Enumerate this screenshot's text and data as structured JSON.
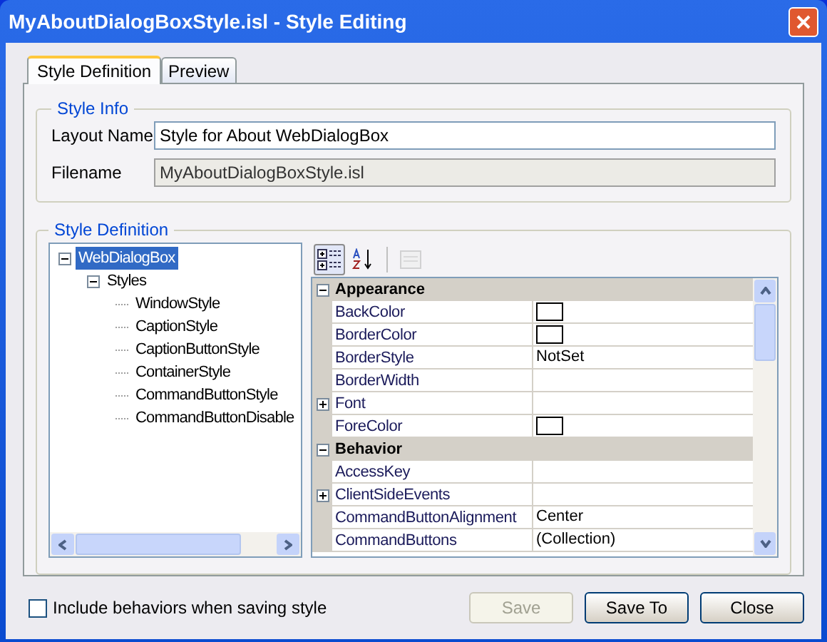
{
  "window": {
    "title": "MyAboutDialogBoxStyle.isl - Style Editing"
  },
  "tabs": [
    {
      "label": "Style Definition",
      "selected": true
    },
    {
      "label": "Preview",
      "selected": false
    }
  ],
  "style_info": {
    "legend": "Style Info",
    "fields": [
      {
        "label": "Layout Name",
        "value": "Style for About WebDialogBox",
        "disabled": false
      },
      {
        "label": "Filename",
        "value": "MyAboutDialogBoxStyle.isl",
        "disabled": true
      }
    ]
  },
  "style_definition": {
    "legend": "Style Definition",
    "tree": [
      {
        "label": "WebDialogBox",
        "selected": true,
        "expanded": true,
        "children": [
          {
            "label": "Styles",
            "selected": false,
            "expanded": true,
            "children": [
              {
                "label": "WindowStyle",
                "selected": false
              },
              {
                "label": "CaptionStyle",
                "selected": false
              },
              {
                "label": "CaptionButtonStyle",
                "selected": false
              },
              {
                "label": "ContainerStyle",
                "selected": false
              },
              {
                "label": "CommandButtonStyle",
                "selected": false
              },
              {
                "label": "CommandButtonDisable",
                "selected": false
              }
            ]
          }
        ]
      }
    ],
    "toolbar": [
      {
        "kind": "categorized",
        "selected": true,
        "disabled": false
      },
      {
        "kind": "alphabetical",
        "selected": false,
        "disabled": false
      },
      {
        "kind": "pages",
        "selected": false,
        "disabled": true
      }
    ],
    "categories": [
      {
        "name": "Appearance",
        "expanded": true,
        "properties": [
          {
            "name": "BackColor",
            "kind": "color",
            "expandable": false,
            "selected": false
          },
          {
            "name": "BorderColor",
            "kind": "color",
            "expandable": false,
            "selected": false
          },
          {
            "name": "BorderStyle",
            "kind": "text",
            "value": "NotSet",
            "expandable": false,
            "selected": false
          },
          {
            "name": "BorderWidth",
            "kind": "text",
            "expandable": false,
            "selected": false
          },
          {
            "name": "Font",
            "kind": "text",
            "expandable": true,
            "selected": false
          },
          {
            "name": "ForeColor",
            "kind": "color",
            "expandable": false,
            "selected": false
          }
        ]
      },
      {
        "name": "Behavior",
        "expanded": true,
        "properties": [
          {
            "name": "AccessKey",
            "kind": "text",
            "expandable": false,
            "selected": false
          },
          {
            "name": "ClientSideEvents",
            "kind": "text",
            "expandable": true,
            "selected": false
          },
          {
            "name": "CommandButtonAlignment",
            "kind": "text",
            "value": "Center",
            "expandable": false,
            "selected": false
          },
          {
            "name": "CommandButtons",
            "kind": "text",
            "value": "(Collection)",
            "expandable": false,
            "selected": false
          }
        ]
      }
    ]
  },
  "include_behaviors": {
    "label": "Include behaviors when saving style",
    "checked": false
  },
  "buttons": [
    {
      "label": "Save",
      "disabled": true
    },
    {
      "label": "Save To",
      "disabled": false
    },
    {
      "label": "Close",
      "disabled": false
    }
  ]
}
